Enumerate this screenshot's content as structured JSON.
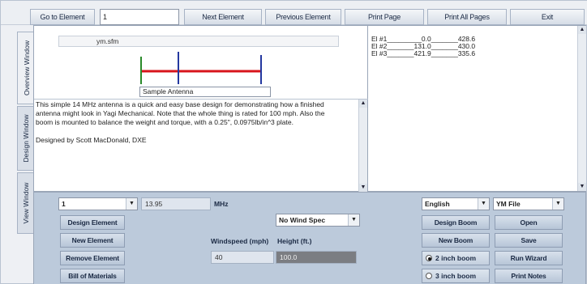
{
  "toolbar": {
    "goto_label": "Go to Element",
    "element_value": "1",
    "next_label": "Next Element",
    "previous_label": "Previous Element",
    "print_page_label": "Print Page",
    "print_all_label": "Print All Pages",
    "exit_label": "Exit"
  },
  "tabs": [
    "Overview Window",
    "Design Window",
    "View Window"
  ],
  "overview": {
    "file_name": "ym.sfm",
    "antenna_name": "Sample Antenna",
    "description_lines": [
      "This simple 14 MHz antenna is a quick and easy base design for demonstrating how a finished",
      "antenna might look in Yagi Mechanical.  Note that the whole thing is rated for 100 mph.  Also the",
      "boom is mounted to balance the weight and torque, with a 0.25\", 0.0975lb/in^3 plate."
    ],
    "designer_line": "Designed by Scott MacDonald, DXE",
    "elements": [
      "El #1_________0.0_______428.6",
      "El #2_______131.0_______430.0",
      "El #3_______421.9_______335.6"
    ],
    "diagram_colors": {
      "element_left": "#2a8a2a",
      "boom": "#d8141c",
      "element": "#2438a0"
    }
  },
  "controls": {
    "element_select": "1",
    "frequency": "13.95",
    "frequency_unit": "MHz",
    "units_select": "English",
    "file_type_select": "YM File",
    "wind_spec_select": "No Wind Spec",
    "windspeed_label": "Windspeed (mph)",
    "height_label": "Height (ft.)",
    "windspeed_value": "40",
    "height_value": "100.0",
    "design_element": "Design Element",
    "new_element": "New Element",
    "remove_element": "Remove Element",
    "bill_of_materials": "Bill of Materials",
    "design_boom": "Design Boom",
    "new_boom": "New Boom",
    "boom_2in": "2 inch boom",
    "boom_3in": "3 inch boom",
    "open": "Open",
    "save": "Save",
    "run_wizard": "Run Wizard",
    "print_notes": "Print Notes"
  }
}
